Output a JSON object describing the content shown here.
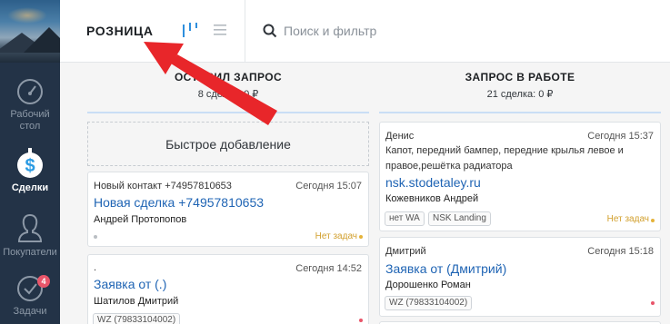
{
  "sidebar": {
    "items": [
      {
        "label_line1": "Рабочий",
        "label_line2": "стол",
        "icon": "speedometer-icon"
      },
      {
        "label": "Сделки",
        "icon": "deals-dollar-icon"
      },
      {
        "label": "Покупатели",
        "icon": "buyers-icon"
      },
      {
        "label": "Задачи",
        "icon": "tasks-check-icon",
        "badge": "4"
      }
    ]
  },
  "header": {
    "title": "РОЗНИЦА",
    "search_placeholder": "Поиск и фильтр"
  },
  "columns": [
    {
      "title": "ОСТАВИЛ ЗАПРОС",
      "summary": "8 сделок: 0 ₽",
      "quick_add": "Быстрое добавление",
      "cards": [
        {
          "contact": "Новый контакт +74957810653",
          "time": "Сегодня 15:07",
          "lead": "Новая сделка +74957810653",
          "person": "Андрей Протопопов",
          "no_tasks": "Нет задач"
        },
        {
          "contact": ".",
          "time": "Сегодня 14:52",
          "lead": "Заявка от (.)",
          "person": "Шатилов Дмитрий",
          "tags": [
            "WZ (79833104002)"
          ]
        }
      ]
    },
    {
      "title": "ЗАПРОС В РАБОТЕ",
      "summary": "21 сделка: 0 ₽",
      "cards": [
        {
          "contact": "Денис",
          "time": "Сегодня 15:37",
          "description_line1": "Капот, передний бампер, передние крылья левое и",
          "description_line2": "правое,решётка радиатора",
          "lead": "nsk.stodetaley.ru",
          "person": "Кожевников Андрей",
          "tags": [
            "нет WA",
            "NSK Landing"
          ],
          "no_tasks": "Нет задач"
        },
        {
          "contact": "Дмитрий",
          "time": "Сегодня 15:18",
          "lead": "Заявка от (Дмитрий)",
          "person": "Дорошенко Роман",
          "tags": [
            "WZ (79833104002)"
          ]
        }
      ]
    }
  ],
  "colors": {
    "sidebar_bg": "#233347",
    "link_blue": "#1f64b4",
    "active_view_blue": "#2f8fdd",
    "column_underline": "#c9def5",
    "no_tasks_yellow": "#d2a02e",
    "badge_red": "#e8556a",
    "annotation_arrow_red": "#e8262a"
  }
}
